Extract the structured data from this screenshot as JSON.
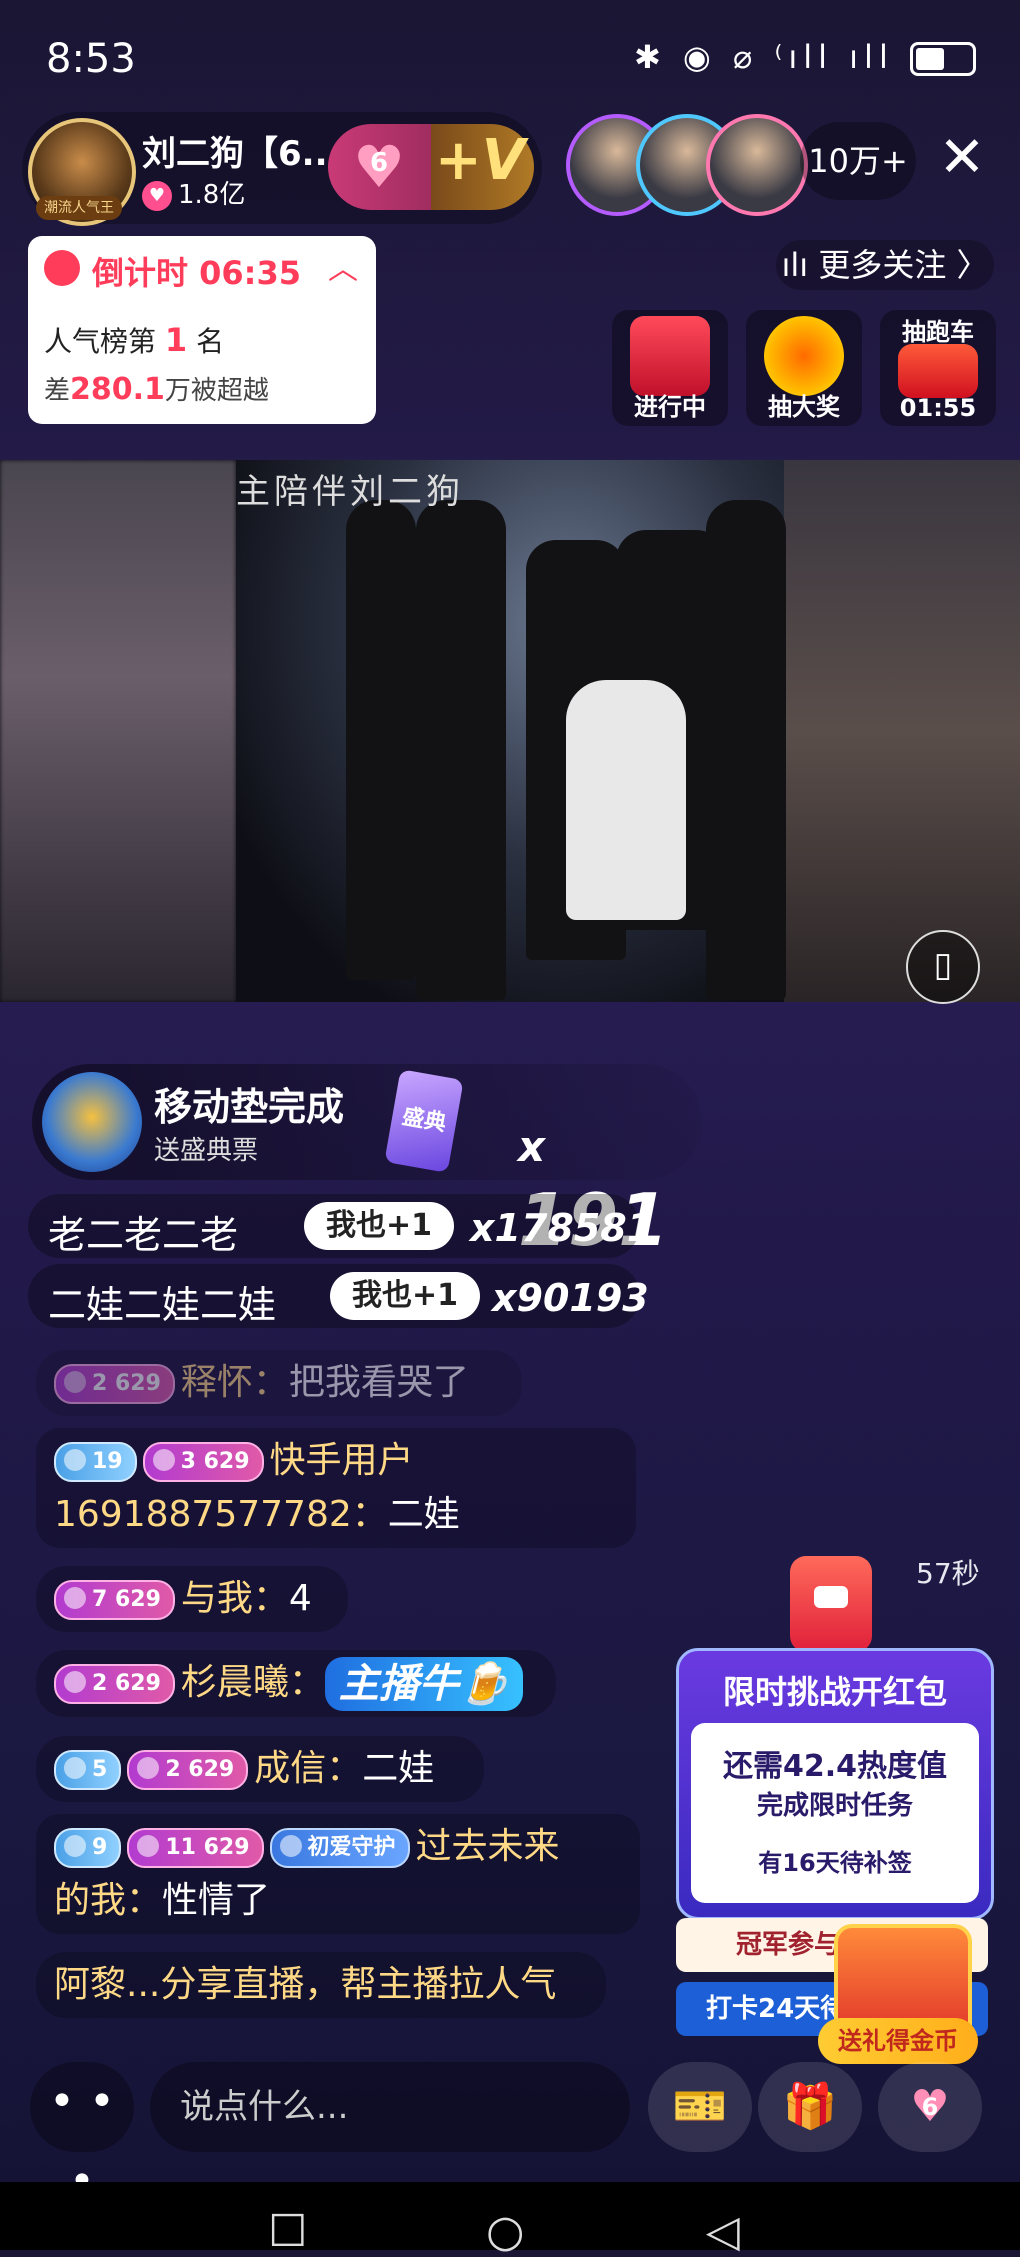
{
  "status_bar": {
    "time": "8:53",
    "icons": "✱ ◉ ⌀ ⁽ıll ıll"
  },
  "host": {
    "name": "刘二狗【6...",
    "likes": "1.8亿",
    "avatar_badge": "潮流人气王",
    "fan_level": "6",
    "fan_plus": "+V"
  },
  "viewers": {
    "count": "10万+",
    "close_icon": "✕"
  },
  "countdown": {
    "title": "倒计时 06:35",
    "rank_prefix": "人气榜第",
    "rank_num": "1",
    "rank_suffix": "名",
    "gap_prefix": "差",
    "gap_num": "280.1",
    "gap_suffix": "万被超越"
  },
  "more_follow": "ılı 更多关注 〉",
  "tiles": [
    {
      "label": "进行中"
    },
    {
      "label": "抽大奖"
    },
    {
      "label": "01:55",
      "top_label": "抽跑车"
    }
  ],
  "video": {
    "caption": "主陪伴刘二狗"
  },
  "gift_banner": {
    "title": "移动垫完成",
    "subtitle": "送盛典票",
    "ticket_text": "盛典",
    "count_x": "x",
    "count": "191"
  },
  "combos": [
    {
      "text": "老二老二老",
      "button": "我也+1",
      "count": "x178581"
    },
    {
      "text": "二娃二娃二娃",
      "button": "我也+1",
      "count": "x90193"
    }
  ],
  "messages": [
    {
      "level": "2 629",
      "name": "释怀：",
      "text": "把我看哭了"
    },
    {
      "badge": "19",
      "level": "3 629",
      "name": "快手用户",
      "name2": "1691887577782：",
      "text": "二娃"
    },
    {
      "level": "7 629",
      "name": "与我：",
      "text": "4"
    },
    {
      "level": "2 629",
      "name": "杉晨曦：",
      "sticker": "主播牛🍺"
    },
    {
      "badge": "5",
      "level": "2 629",
      "name": "成信：",
      "text": "二娃"
    },
    {
      "badge": "9",
      "level": "11 629",
      "guard": "初爱守护",
      "name": "过去未来",
      "name2": "的我：",
      "text": "性情了"
    },
    {
      "system": "阿黎...分享直播，帮主播拉人气"
    }
  ],
  "red_packet": {
    "timer": "57秒",
    "title": "限时挑战开红包",
    "need": "还需42.4热度值",
    "task": "完成限时任务",
    "sign": "有16天待补签",
    "champion": "冠军参与赛",
    "checkin": "打卡24天待",
    "coin_btn": "送礼得金币"
  },
  "bottom": {
    "more": "• • •",
    "placeholder": "说点什么...",
    "fan_num": "6"
  },
  "nav": {
    "square": "☐",
    "circle": "○",
    "back": "◁"
  },
  "colors": {
    "accent": "#ff3d5a",
    "gold": "#ffd985",
    "bg": "#221a45"
  }
}
